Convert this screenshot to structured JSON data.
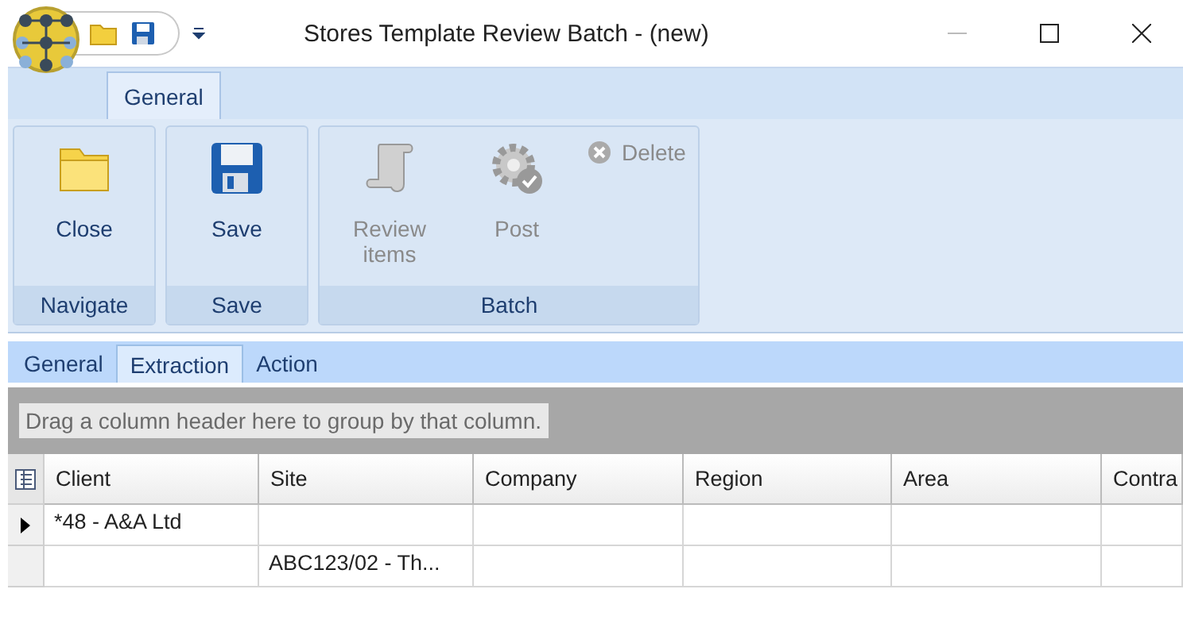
{
  "window": {
    "title": "Stores Template Review Batch - (new)"
  },
  "ribbon_tabs": [
    {
      "label": "General",
      "selected": true
    }
  ],
  "ribbon_groups": [
    {
      "label": "Navigate",
      "items": [
        {
          "kind": "folder",
          "label": "Close",
          "disabled": false
        }
      ]
    },
    {
      "label": "Save",
      "items": [
        {
          "kind": "disk",
          "label": "Save",
          "disabled": false
        }
      ]
    },
    {
      "label": "Batch",
      "items": [
        {
          "kind": "scroll",
          "label": "Review items",
          "disabled": true
        },
        {
          "kind": "gear",
          "label": "Post",
          "disabled": true
        },
        {
          "kind": "delete",
          "label": "Delete",
          "disabled": true
        }
      ]
    }
  ],
  "tabs": [
    {
      "label": "General",
      "selected": false
    },
    {
      "label": "Extraction",
      "selected": true
    },
    {
      "label": "Action",
      "selected": false
    }
  ],
  "group_panel": {
    "placeholder": "Drag a column header here to group by that column."
  },
  "table": {
    "columns": [
      "Client",
      "Site",
      "Company",
      "Region",
      "Area",
      "Contra"
    ],
    "rows": [
      {
        "current": true,
        "cells": [
          "*48 - A&A Ltd",
          "",
          "",
          "",
          "",
          ""
        ]
      },
      {
        "current": false,
        "cells": [
          "",
          "ABC123/02 - Th...",
          "",
          "",
          "",
          ""
        ]
      }
    ]
  }
}
